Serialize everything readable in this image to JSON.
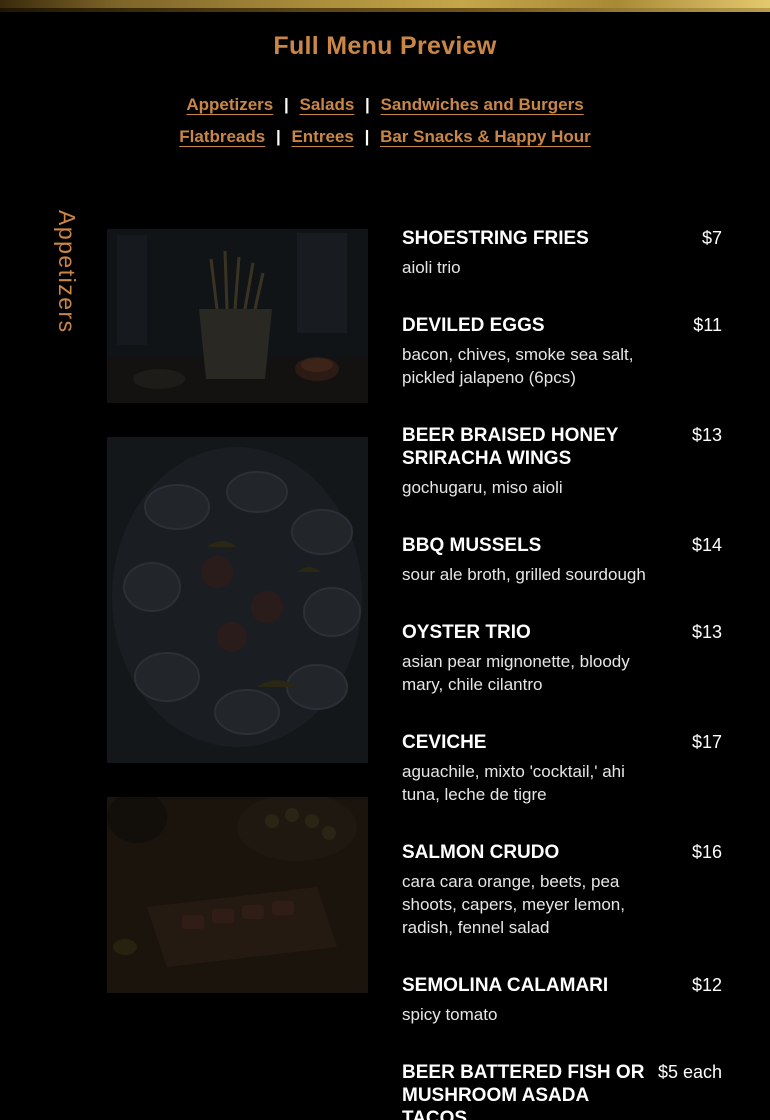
{
  "page": {
    "title": "Full Menu Preview",
    "section_label": "Appetizers"
  },
  "nav": {
    "row1": [
      "Appetizers",
      "Salads",
      "Sandwiches and Burgers"
    ],
    "row2": [
      "Flatbreads",
      "Entrees",
      "Bar Snacks & Happy Hour"
    ],
    "separator": "|"
  },
  "photos": [
    {
      "name": "fries-photo"
    },
    {
      "name": "oysters-photo"
    },
    {
      "name": "crudo-photo"
    }
  ],
  "items": [
    {
      "name": "SHOESTRING FRIES",
      "price": "$7",
      "desc": "aioli trio"
    },
    {
      "name": "DEVILED EGGS",
      "price": "$11",
      "desc": "bacon, chives, smoke sea salt, pickled jalapeno (6pcs)"
    },
    {
      "name": "BEER BRAISED HONEY SRIRACHA WINGS",
      "price": "$13",
      "desc": "gochugaru, miso aioli"
    },
    {
      "name": "BBQ MUSSELS",
      "price": "$14",
      "desc": "sour ale broth, grilled sourdough"
    },
    {
      "name": "OYSTER TRIO",
      "price": "$13",
      "desc": "asian pear mignonette, bloody mary, chile cilantro"
    },
    {
      "name": "CEVICHE",
      "price": "$17",
      "desc": "aguachile, mixto 'cocktail,' ahi tuna, leche de tigre"
    },
    {
      "name": "SALMON CRUDO",
      "price": "$16",
      "desc": "cara cara orange, beets, pea shoots, capers, meyer lemon, radish, fennel salad"
    },
    {
      "name": "SEMOLINA CALAMARI",
      "price": "$12",
      "desc": "spicy tomato"
    },
    {
      "name": "BEER BATTERED FISH OR MUSHROOM ASADA TACOS",
      "price": "$5 each",
      "desc": ""
    }
  ],
  "colors": {
    "accent": "#c98645",
    "background": "#000000",
    "text": "#ffffff"
  }
}
